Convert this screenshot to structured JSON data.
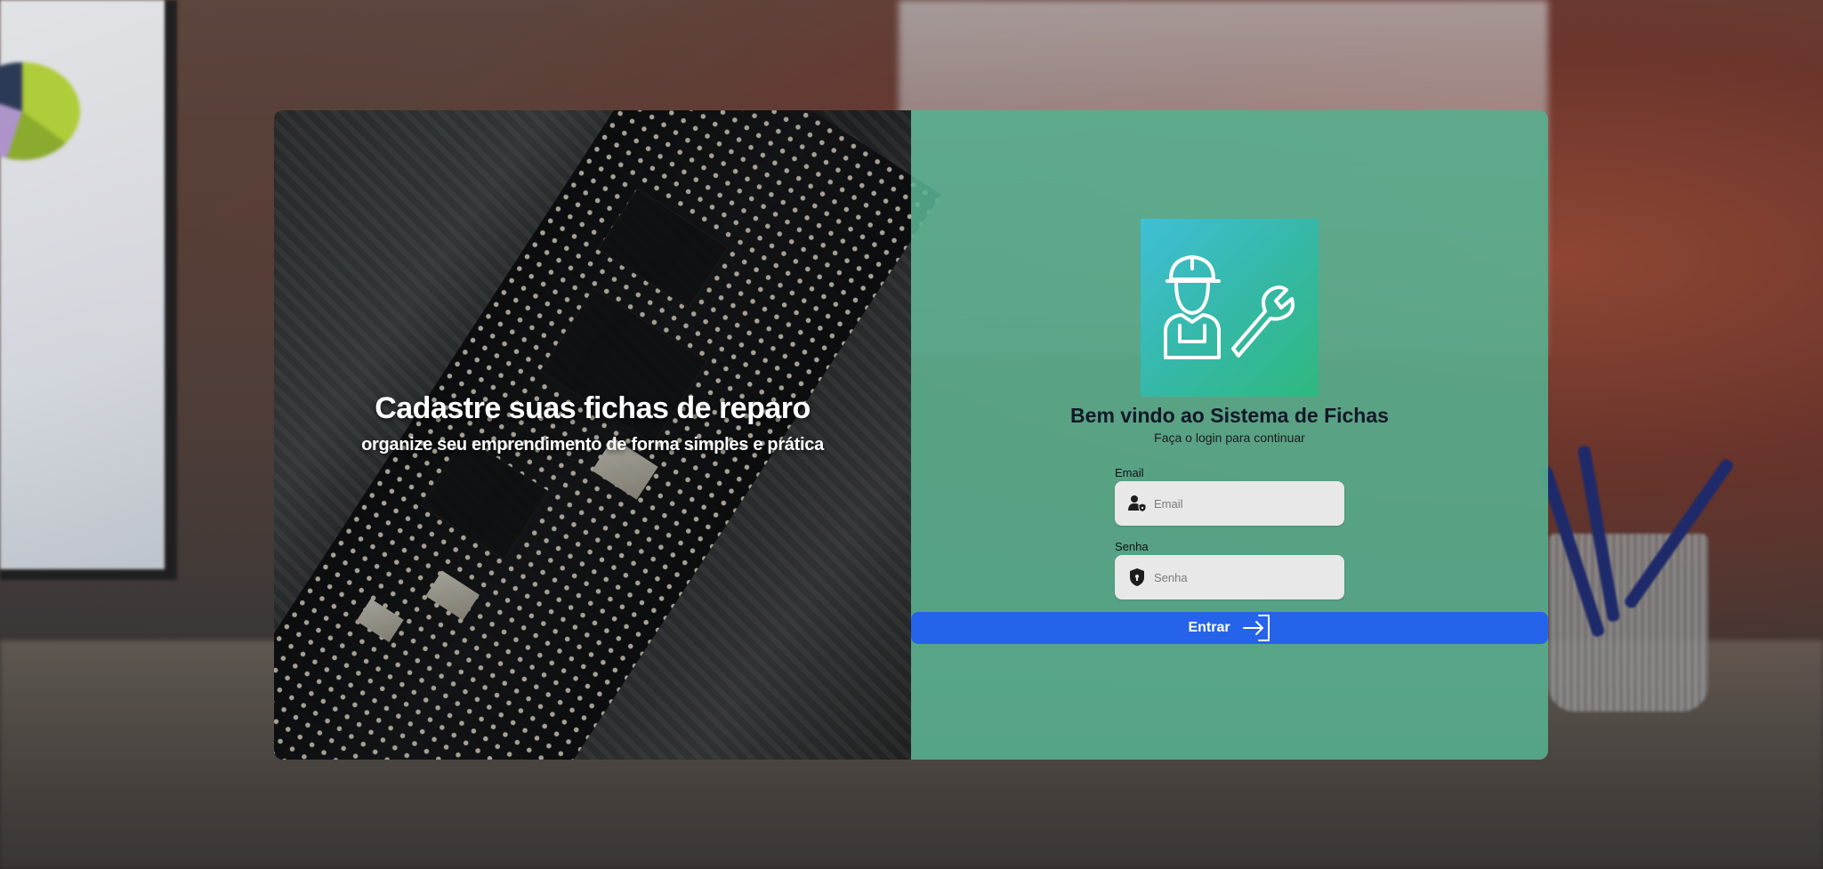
{
  "hero": {
    "title": "Cadastre suas fichas de reparo",
    "subtitle": "organize seu emprendimento de forma simples e prática"
  },
  "login": {
    "logo_icon": "technician-wrench-icon",
    "welcome_title": "Bem vindo ao Sistema de Fichas",
    "welcome_subtitle": "Faça o login para continuar",
    "email": {
      "label": "Email",
      "placeholder": "Email",
      "value": "",
      "icon": "user-shield-icon"
    },
    "password": {
      "label": "Senha",
      "placeholder": "Senha",
      "value": "",
      "icon": "lock-shield-icon"
    },
    "submit": {
      "label": "Entrar",
      "icon": "login-arrow-icon",
      "color": "#2563eb"
    }
  },
  "colors": {
    "panel_green": "#58ae8e",
    "logo_gradient_start": "#3fbfd6",
    "logo_gradient_end": "#2fb87e",
    "input_bg": "#e8e8e8",
    "title_text": "#111827"
  }
}
